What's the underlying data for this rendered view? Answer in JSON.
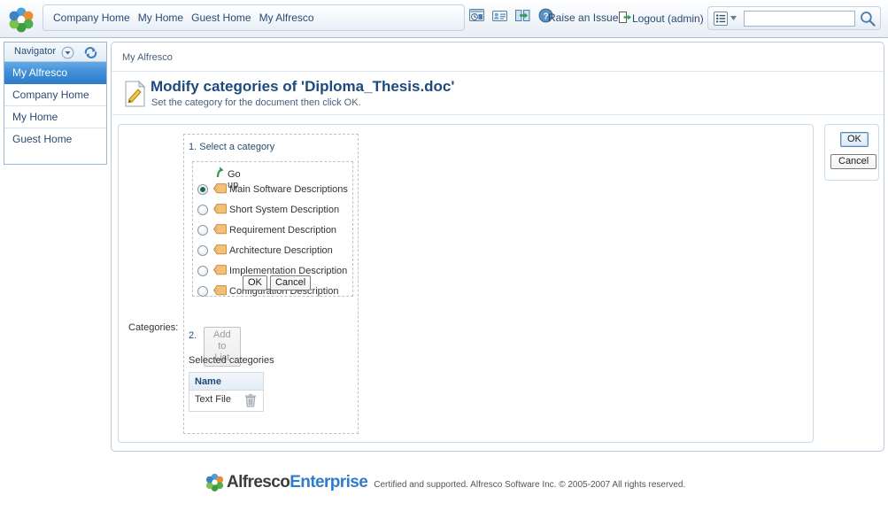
{
  "topbar": {
    "logo_icon": "alfresco-petal-logo",
    "nav_links": [
      {
        "label": "Company Home",
        "name": "nav-company-home"
      },
      {
        "label": "My Home",
        "name": "nav-my-home"
      },
      {
        "label": "Guest Home",
        "name": "nav-guest-home"
      },
      {
        "label": "My Alfresco",
        "name": "nav-my-alfresco"
      }
    ],
    "tool_icons": [
      {
        "name": "system-clock-icon",
        "title": "System"
      },
      {
        "name": "user-profile-card-icon",
        "title": "User Profile"
      },
      {
        "name": "window-switch-icon",
        "title": "Shortcuts"
      },
      {
        "name": "help-question-icon",
        "title": "Help"
      }
    ],
    "raise_issue_label": "Raise an Issue",
    "logout_label": "Logout (admin)",
    "logout_icon": "logout-arrow-icon",
    "search": {
      "mode_icon": "search-options-list-icon",
      "chevron_icon": "chevron-down-icon",
      "value": "",
      "placeholder": "",
      "go_icon": "magnifier-icon"
    }
  },
  "sidebar": {
    "header_label": "Navigator",
    "chevron_icon": "chevron-down-circle-icon",
    "refresh_icon": "refresh-arrows-icon",
    "items": [
      {
        "label": "My Alfresco",
        "name": "sidebar-item-my-alfresco",
        "selected": true
      },
      {
        "label": "Company Home",
        "name": "sidebar-item-company-home",
        "selected": false
      },
      {
        "label": "My Home",
        "name": "sidebar-item-my-home",
        "selected": false
      },
      {
        "label": "Guest Home",
        "name": "sidebar-item-guest-home",
        "selected": false
      }
    ]
  },
  "main": {
    "breadcrumb": "My Alfresco",
    "title_icon": "document-edit-pencil-icon",
    "title": "Modify categories of 'Diploma_Thesis.doc'",
    "subtitle": "Set the category for the document then click OK.",
    "categories_label": "Categories:",
    "step1_label": "1. Select a category",
    "go_up": {
      "label": "Go up",
      "icon": "go-up-arrow-icon"
    },
    "category_items": [
      {
        "label": "Main Software Descriptions",
        "selected": true,
        "icon": "category-tag-icon"
      },
      {
        "label": "Short System Description",
        "selected": false,
        "icon": "category-tag-icon"
      },
      {
        "label": "Requirement Description",
        "selected": false,
        "icon": "category-tag-icon"
      },
      {
        "label": "Architecture Description",
        "selected": false,
        "icon": "category-tag-icon"
      },
      {
        "label": "Implementation Description",
        "selected": false,
        "icon": "category-tag-icon"
      },
      {
        "label": "Configuration Description",
        "selected": false,
        "icon": "category-tag-icon"
      }
    ],
    "picker_ok_label": "OK",
    "picker_cancel_label": "Cancel",
    "step2_number": "2.",
    "add_to_list_label": "Add to List",
    "add_to_list_disabled": true,
    "selected_categories_label": "Selected categories",
    "selected_table": {
      "columns": [
        "Name"
      ],
      "rows": [
        {
          "name": "Text File",
          "delete_icon": "trash-can-icon"
        }
      ]
    },
    "action_ok_label": "OK",
    "action_cancel_label": "Cancel"
  },
  "footer": {
    "logo_icon": "alfresco-petal-logo",
    "word_primary": "Alfresco",
    "word_secondary": "Enterprise",
    "copyright": "Certified and supported. Alfresco Software Inc. © 2005-2007 All rights reserved."
  },
  "colors": {
    "accent_blue": "#2f7dc9",
    "title_blue": "#1c4a7e",
    "link_blue": "#2a4a73",
    "tag_orange": "#f0b35c",
    "selected_radio_green": "#1c6b4c"
  }
}
